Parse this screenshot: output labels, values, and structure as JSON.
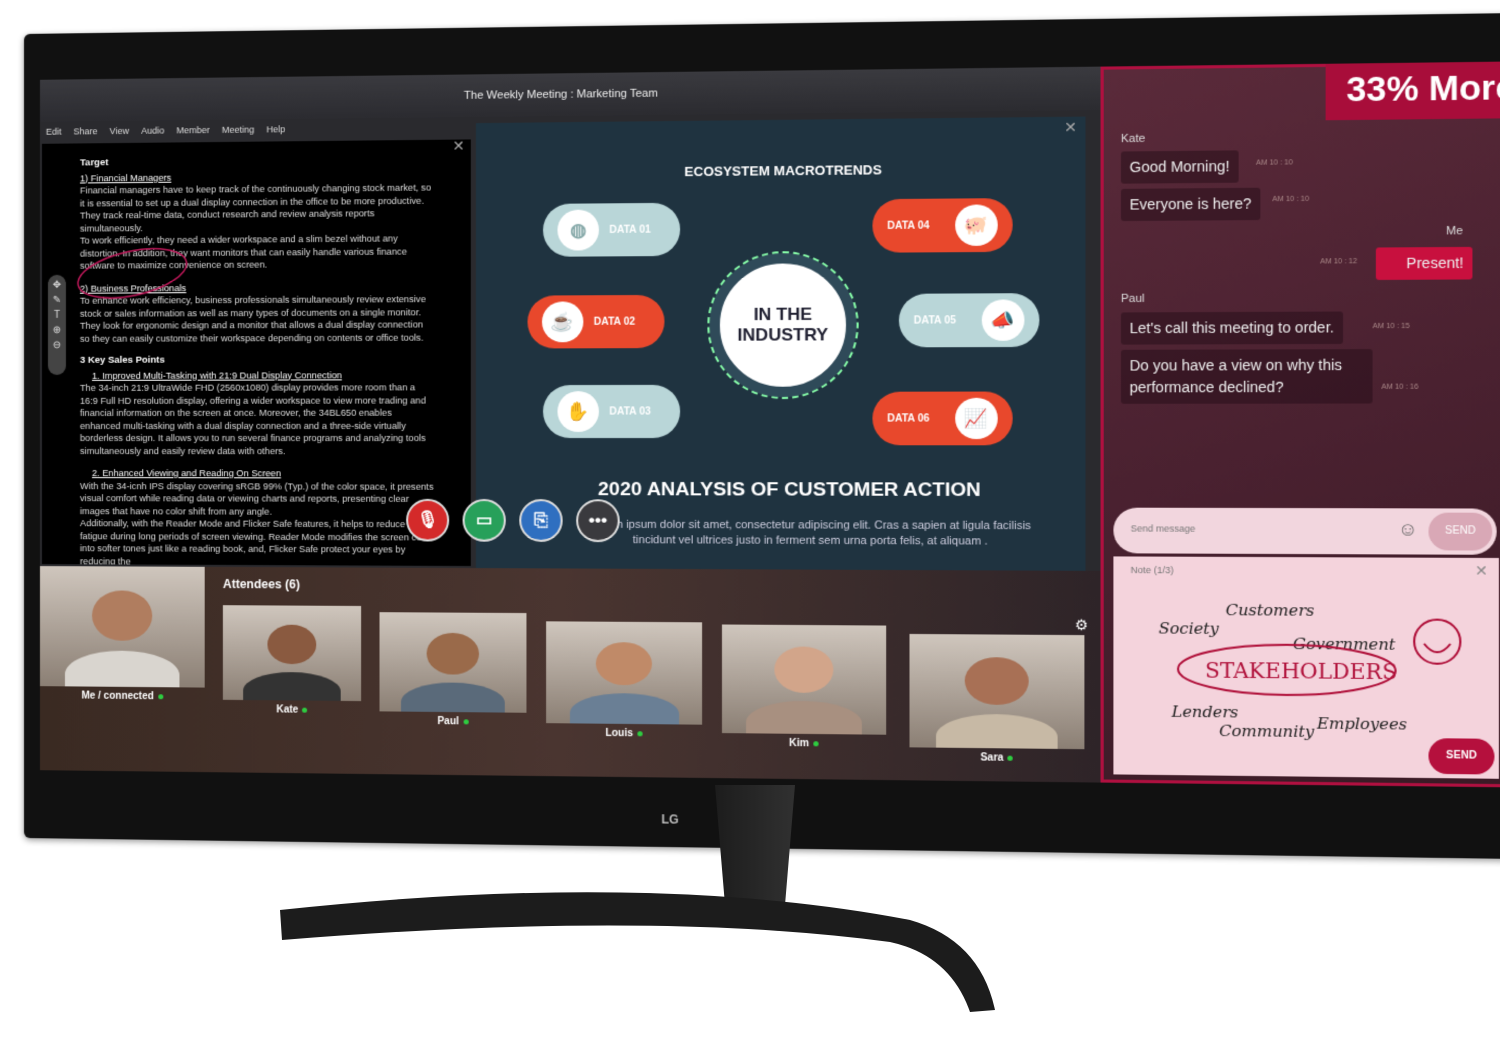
{
  "window": {
    "title": "The Weekly Meeting : Marketing Team",
    "menu": [
      "Edit",
      "Share",
      "View",
      "Audio",
      "Member",
      "Meeting",
      "Help"
    ]
  },
  "document": {
    "heading": "Target",
    "s1_title": "1) Financial Managers",
    "s1_p1": "Financial managers have to keep track of the continuously changing stock market, so it is essential to set up a dual display connection in the office to be more productive. They track real-time data, conduct research and review analysis reports simultaneously.",
    "s1_p2": "To work efficiently, they need a wider workspace and a slim bezel without any distortion. In addition, they want monitors that can easily handle various finance software to maximize convenience on screen.",
    "s2_title": "2) Business Professionals",
    "s2_p": "To enhance work efficiency, business professionals simultaneously review extensive stock or sales information as well as many types of documents on a single monitor. They look for ergonomic design and a monitor that allows a dual display connection so they can easily customize their workspace depending on contents or office tools.",
    "s3_title": "3 Key Sales Points",
    "k1_title": "1.  Improved Multi-Tasking with 21:9 Dual Display Connection",
    "k1_p": "The 34-inch 21:9 UltraWide FHD (2560x1080) display provides more room than a 16:9 Full HD resolution display, offering a wider workspace to view more trading and financial information on the screen at once. Moreover, the 34BL650 enables enhanced multi-tasking with a dual display connection and a three-side virtually borderless design. It allows you to run several finance programs and analyzing tools simultaneously and easily review data with others.",
    "k2_title": "2.  Enhanced Viewing and Reading On Screen",
    "k2_p1": "With the 34-icnh IPS display covering sRGB 99% (Typ.) of the color space, it presents visual comfort while reading data or viewing charts and reports, presenting clear images that have no color shift from any angle.",
    "k2_p2": "Additionally, with the Reader Mode and Flicker Safe features, it helps to reduce visual fatigue during long periods of screen viewing. Reader Mode modifies the screen color into softer tones just like a reading book, and, Flicker Safe protect your eyes by reducing the"
  },
  "slide": {
    "title": "ECOSYSTEM MACROTRENDS",
    "center": "IN THE INDUSTRY",
    "items": [
      {
        "label": "DATA 01",
        "icon": "globe"
      },
      {
        "label": "DATA 02",
        "icon": "coffee"
      },
      {
        "label": "DATA 03",
        "icon": "handshake"
      },
      {
        "label": "DATA 04",
        "icon": "piggy-bank"
      },
      {
        "label": "DATA 05",
        "icon": "megaphone"
      },
      {
        "label": "DATA 06",
        "icon": "chart-up"
      }
    ],
    "analysis_title": "2020 ANALYSIS OF CUSTOMER ACTION",
    "analysis_text": "Lorem ipsum dolor sit amet, consectetur adipiscing elit. Cras a sapien at ligula facilisis tincidunt vel ultrices justo in ferment sem urna porta felis, at aliquam ."
  },
  "call_controls": [
    {
      "icon": "microphone",
      "color": "#d42a2a"
    },
    {
      "icon": "video",
      "color": "#27a05a"
    },
    {
      "icon": "share-screen",
      "color": "#2f6fc0"
    },
    {
      "icon": "more",
      "color": "#3a3a3e"
    }
  ],
  "attendees": {
    "title": "Attendees (6)",
    "people": [
      "Me / connected",
      "Kate",
      "Paul",
      "Louis",
      "Kim",
      "Sara"
    ]
  },
  "badge": "33% More",
  "chat": {
    "messages": [
      {
        "sender": "Kate",
        "text": "Good Morning!",
        "time": "AM 10 : 10"
      },
      {
        "text": "Everyone is here?",
        "time": "AM 10 : 10"
      },
      {
        "sender": "Me",
        "text": "Present!",
        "time": "AM 10 : 12"
      },
      {
        "sender": "Paul",
        "text": "Let's call this meeting to order.",
        "time": "AM 10 : 15"
      },
      {
        "text": "Do you have a view on why this performance  declined?",
        "time": "AM 10 : 16"
      }
    ],
    "input_placeholder": "Send message",
    "send_label": "SEND"
  },
  "note": {
    "title": "Note (1/3)",
    "words": [
      "Customers",
      "Society",
      "Government",
      "STAKEHOLDERS",
      "Lenders",
      "Community",
      "Employees"
    ],
    "send_label": "SEND"
  },
  "brand": "LG",
  "colors": {
    "accent": "#a80d3a",
    "slide_bg": "#1f3340",
    "orange": "#e8482c",
    "teal": "#b9d6d8"
  }
}
